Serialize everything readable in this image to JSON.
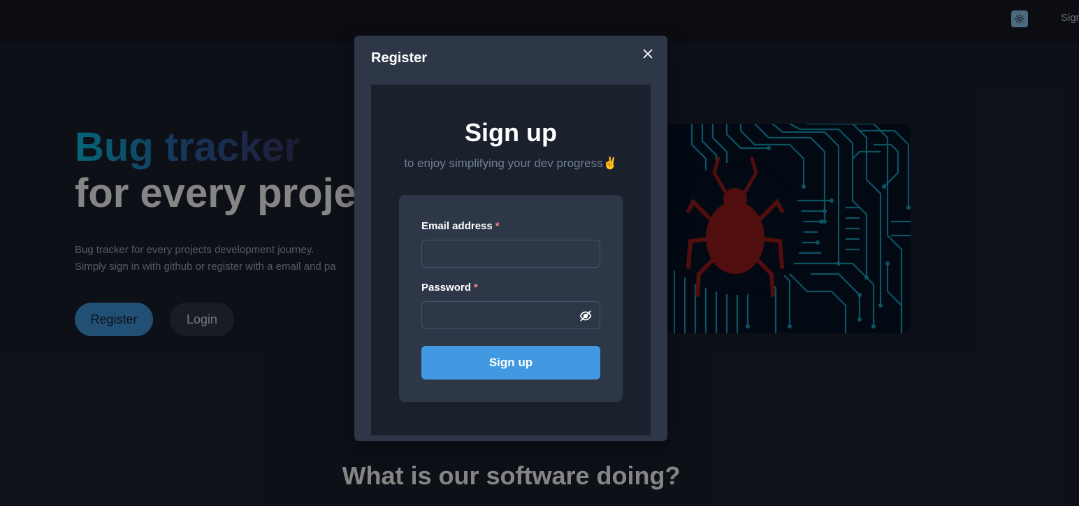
{
  "navbar": {
    "theme_toggle_icon": "sun-icon",
    "signin_label": "Sign"
  },
  "hero": {
    "title_line1": "Bug tracker",
    "title_line2": "for every proje",
    "description_line1": "Bug tracker for every projects development journey.",
    "description_line2": "Simply sign in with github or register with a email and pa",
    "register_label": "Register",
    "login_label": "Login",
    "image_icon": "bug-circuit-illustration"
  },
  "section": {
    "heading": "What is our software doing?"
  },
  "modal": {
    "title": "Register",
    "close_icon": "close-icon",
    "heading": "Sign up",
    "subtitle": "to enjoy simplifying your dev progress✌️",
    "form": {
      "email_label": "Email address",
      "email_value": "",
      "password_label": "Password",
      "password_value": "",
      "required_marker": "*",
      "eye_icon": "eye-off-icon",
      "submit_label": "Sign up"
    }
  },
  "colors": {
    "accent": "#4299e1",
    "modal_bg": "#2d3748",
    "page_bg": "#1a202c",
    "required": "#fc8181"
  }
}
